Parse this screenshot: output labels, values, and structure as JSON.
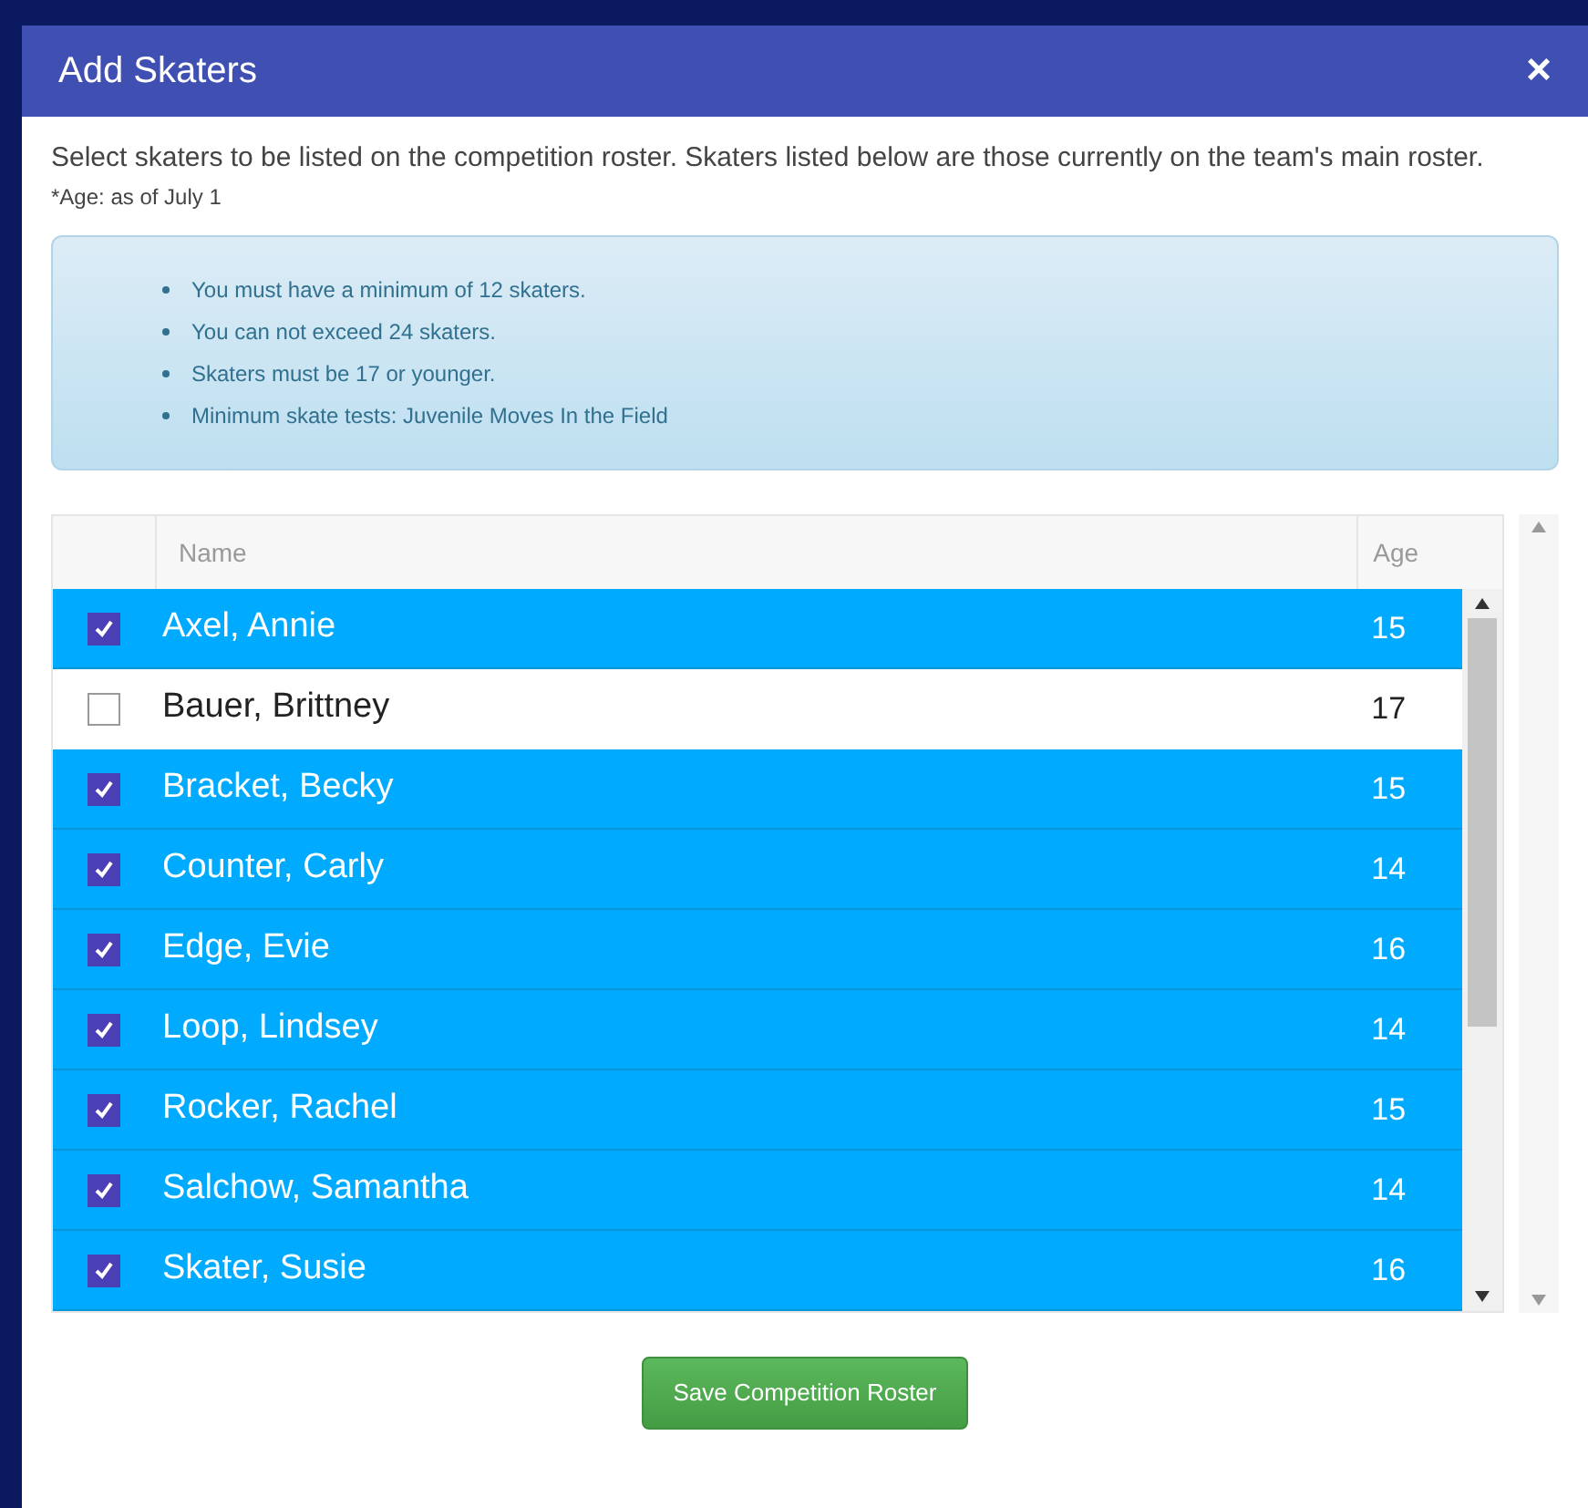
{
  "dialog": {
    "title": "Add Skaters",
    "close": "×",
    "intro": "Select skaters to be listed on the competition roster. Skaters listed below are those currently on the team's main roster.",
    "age_note": "*Age: as of July 1",
    "rules": [
      "You must have a minimum of 12 skaters.",
      "You can not exceed 24 skaters.",
      "Skaters must be 17 or younger.",
      "Minimum skate tests: Juvenile Moves In the Field"
    ],
    "table": {
      "columns": [
        "Name",
        "Age"
      ],
      "rows": [
        {
          "name": "Axel, Annie",
          "age": "15",
          "checked": true
        },
        {
          "name": "Bauer, Brittney",
          "age": "17",
          "checked": false
        },
        {
          "name": "Bracket, Becky",
          "age": "15",
          "checked": true
        },
        {
          "name": "Counter, Carly",
          "age": "14",
          "checked": true
        },
        {
          "name": "Edge, Evie",
          "age": "16",
          "checked": true
        },
        {
          "name": "Loop, Lindsey",
          "age": "14",
          "checked": true
        },
        {
          "name": "Rocker, Rachel",
          "age": "15",
          "checked": true
        },
        {
          "name": "Salchow, Samantha",
          "age": "14",
          "checked": true
        },
        {
          "name": "Skater, Susie",
          "age": "16",
          "checked": true
        }
      ]
    },
    "save_button": "Save Competition Roster"
  }
}
